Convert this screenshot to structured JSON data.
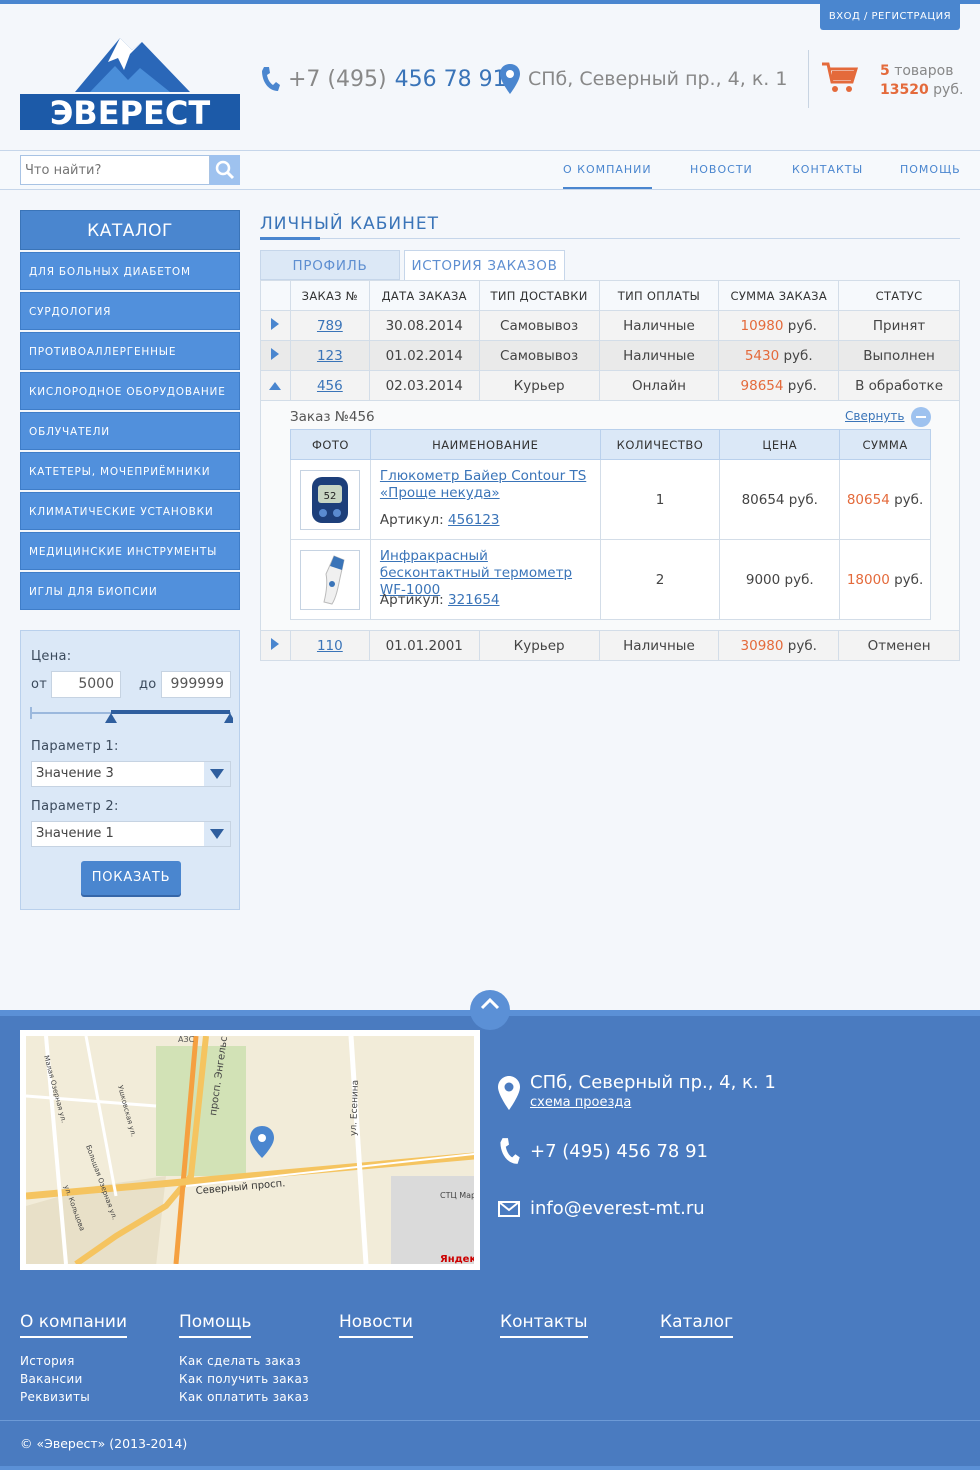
{
  "header": {
    "login_label": "ВХОД / РЕГИСТРАЦИЯ",
    "logo_text": "ЭВЕРЕСТ",
    "phone_prefix": "+7 (495)",
    "phone_number": "456 78 91",
    "address": "СПб, Северный пр., 4, к. 1",
    "cart_count": "5",
    "cart_count_suffix": "товаров",
    "cart_sum": "13520",
    "cart_sum_suffix": "руб."
  },
  "nav": {
    "search_placeholder": "Что найти?",
    "items": [
      "О КОМПАНИИ",
      "НОВОСТИ",
      "КОНТАКТЫ",
      "ПОМОЩЬ"
    ]
  },
  "catalog": {
    "title": "КАТАЛОГ",
    "items": [
      "ДЛЯ БОЛЬНЫХ ДИАБЕТОМ",
      "СУРДОЛОГИЯ",
      "ПРОТИВОАЛЛЕРГЕННЫЕ",
      "КИСЛОРОДНОЕ ОБОРУДОВАНИЕ",
      "ОБЛУЧАТЕЛИ",
      "КАТЕТЕРЫ, МОЧЕПРИЁМНИКИ",
      "КЛИМАТИЧЕСКИЕ УСТАНОВКИ",
      "МЕДИЦИНСКИЕ ИНСТРУМЕНТЫ",
      "ИГЛЫ ДЛЯ БИОПСИИ"
    ]
  },
  "filter": {
    "price_label": "Цена:",
    "from_label": "от",
    "from_value": "5000",
    "to_label": "до",
    "to_value": "999999",
    "param1_label": "Параметр 1:",
    "param1_value": "Значение 3",
    "param2_label": "Параметр 2:",
    "param2_value": "Значение 1",
    "button": "ПОКАЗАТЬ"
  },
  "page": {
    "title": "ЛИЧНЫЙ КАБИНЕТ",
    "tabs": [
      "ПРОФИЛЬ",
      "ИСТОРИЯ ЗАКАЗОВ"
    ]
  },
  "orders": {
    "headers": [
      "ЗАКАЗ №",
      "ДАТА ЗАКАЗА",
      "ТИП ДОСТАВКИ",
      "ТИП ОПЛАТЫ",
      "СУММА ЗАКАЗА",
      "СТАТУС"
    ],
    "currency": "руб.",
    "rows": [
      {
        "id": "789",
        "date": "30.08.2014",
        "delivery": "Самовывоз",
        "payment": "Наличные",
        "sum": "10980",
        "status": "Принят"
      },
      {
        "id": "123",
        "date": "01.02.2014",
        "delivery": "Самовывоз",
        "payment": "Наличные",
        "sum": "5430",
        "status": "Выполнен"
      },
      {
        "id": "456",
        "date": "02.03.2014",
        "delivery": "Курьер",
        "payment": "Онлайн",
        "sum": "98654",
        "status": "В обработке"
      },
      {
        "id": "110",
        "date": "01.01.2001",
        "delivery": "Курьер",
        "payment": "Наличные",
        "sum": "30980",
        "status": "Отменен"
      }
    ],
    "detail": {
      "title": "Заказ №456",
      "collapse": "Свернуть",
      "headers": [
        "ФОТО",
        "НАИМЕНОВАНИЕ",
        "КОЛИЧЕСТВО",
        "ЦЕНА",
        "СУММА"
      ],
      "article_label": "Артикул:",
      "items": [
        {
          "name": "Глюкометр Байер Contour TS «Проще некуда»",
          "article": "456123",
          "qty": "1",
          "price": "80654 руб.",
          "sum": "80654"
        },
        {
          "name": "Инфракрасный бесконтактный термометр WF-1000",
          "article": "321654",
          "qty": "2",
          "price": "9000 руб.",
          "sum": "18000"
        }
      ]
    }
  },
  "footer": {
    "address": "СПб, Северный пр., 4, к. 1",
    "route_link": "схема проезда",
    "phone": "+7 (495) 456 78 91",
    "email": "info@everest-mt.ru",
    "map_labels": [
      "АЗС",
      "просп. Энгельса",
      "ул. Есенина",
      "Северный просп.",
      "СТЦ Мар",
      "Яндекс",
      "ул. Кольцова",
      "Большая Озерная ул.",
      "Ушковская ул.",
      "Малая Озерная ул."
    ],
    "columns": [
      {
        "title": "О компании",
        "links": [
          "История",
          "Вакансии",
          "Реквизиты"
        ]
      },
      {
        "title": "Помощь",
        "links": [
          "Как сделать заказ",
          "Как получить заказ",
          "Как оплатить заказ"
        ]
      },
      {
        "title": "Новости",
        "links": []
      },
      {
        "title": "Контакты",
        "links": []
      },
      {
        "title": "Каталог",
        "links": []
      }
    ],
    "copyright": "© «Эверест» (2013-2014)"
  },
  "colors": {
    "accent": "#4a86cf",
    "sum": "#e46a3b",
    "accepted": "#888888",
    "done": "#5e8f1d",
    "processing": "#e8a020",
    "cancelled": "#c4341e"
  }
}
